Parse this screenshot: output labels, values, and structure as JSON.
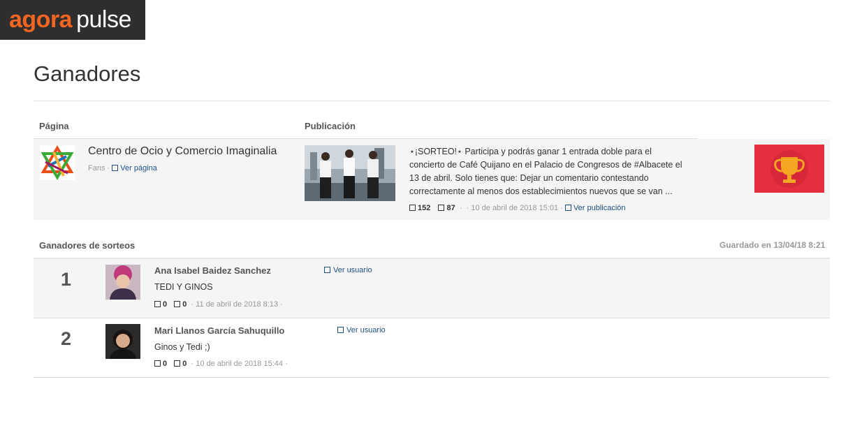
{
  "brand": {
    "part1": "agora",
    "part2": "pulse"
  },
  "page_title": "Ganadores",
  "table_headers": {
    "page": "Página",
    "post": "Publicación"
  },
  "page_info": {
    "name": "Centro de Ocio y Comercio Imaginalia",
    "fans_label": "Fans",
    "view_page": "Ver página"
  },
  "post": {
    "text": "⋆¡SORTEO!⋆ Participa y podrás ganar 1 entrada doble para el concierto de Café Quijano en el Palacio de Congresos de #Albacete el 13 de abril. Solo tienes que: Dejar un comentario contestando correctamente al menos dos establecimientos nuevos que se van ...",
    "likes": "152",
    "comments": "87",
    "date": "10 de abril de 2018 15:01",
    "view_post": "Ver publicación"
  },
  "draw_section": {
    "label": "Ganadores de sorteos",
    "saved": "Guardado en 13/04/18 8:21"
  },
  "winners": [
    {
      "rank": "1",
      "name": "Ana Isabel Baidez Sanchez",
      "comment": "TEDI Y GINOS",
      "likes": "0",
      "replies": "0",
      "date": "11 de abril de 2018 8:13",
      "view_user": "Ver usuario"
    },
    {
      "rank": "2",
      "name": "Mari Llanos García Sahuquillo",
      "comment": "Ginos y Tedi ;)",
      "likes": "0",
      "replies": "0",
      "date": "10 de abril de 2018 15:44",
      "view_user": "Ver usuario"
    }
  ],
  "colors": {
    "brand_orange": "#f26522",
    "link_blue": "#1f4f82",
    "trophy_red": "#e52f3e",
    "trophy_gold": "#f5a623"
  },
  "icons": {
    "trophy": "trophy-icon",
    "checkbox": "checkbox-icon"
  }
}
